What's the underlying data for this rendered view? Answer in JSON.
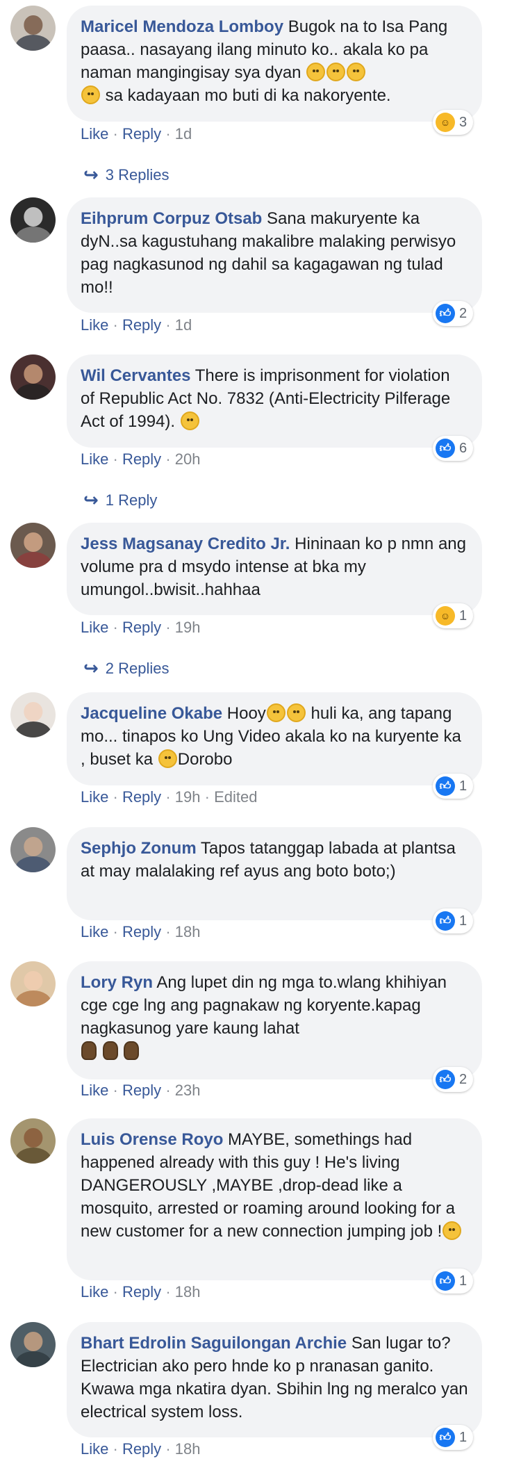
{
  "labels": {
    "like": "Like",
    "reply": "Reply",
    "sep": "·",
    "edited": "Edited"
  },
  "colors": {
    "link": "#385898",
    "bubble": "#f2f3f5",
    "like_blue": "#1877f2",
    "haha_yellow": "#f7b928"
  },
  "comments": [
    {
      "name": "Maricel Mendoza Lomboy",
      "text": " Bugok na to Isa Pang paasa.. nasayang ilang minuto ko.. akala ko pa naman mangingisay sya dyan ",
      "text_after": " sa kadayaan mo buti di ka nakoryente.",
      "emojis_inline": [
        "rofl-emoji",
        "rofl-emoji",
        "rofl-emoji"
      ],
      "emoji_start_line": "rofl-emoji",
      "time": "1d",
      "reaction": {
        "icon": "haha-icon",
        "count": "3"
      },
      "replies_label": "3 Replies"
    },
    {
      "name": "Eihprum Corpuz Otsab",
      "text": " Sana makuryente ka dyN..sa kagustuhang makalibre malaking perwisyo pag nagkasunod ng dahil sa kagagawan ng tulad mo!!",
      "time": "1d",
      "reaction": {
        "icon": "like-icon",
        "count": "2"
      }
    },
    {
      "name": "Wil Cervantes",
      "text": " There is imprisonment for violation of Republic Act No. 7832 (Anti-Electricity Pilferage Act of 1994). ",
      "emoji_end": "thinking-emoji",
      "time": "20h",
      "reaction": {
        "icon": "like-icon",
        "count": "6"
      },
      "replies_label": "1 Reply"
    },
    {
      "name": "Jess Magsanay Credito Jr.",
      "text": " Hininaan ko p nmn ang volume pra d msydo intense at bka my umungol..bwisit..hahhaa",
      "time": "19h",
      "reaction": {
        "icon": "haha-icon",
        "count": "1"
      },
      "replies_label": "2 Replies"
    },
    {
      "name": "Jacqueline Okabe",
      "text_a": " Hooy",
      "text_b": " huli ka, ang tapang mo... tinapos ko Ung Video akala ko na kuryente ka , buset ka ",
      "text_c": "Dorobo",
      "time": "19h",
      "edited": true,
      "reaction": {
        "icon": "like-icon",
        "count": "1"
      }
    },
    {
      "name": "Sephjo Zonum",
      "text": " Tapos tatanggap labada at plantsa at may malalaking ref ayus ang boto boto;)",
      "time": "18h",
      "reaction": {
        "icon": "like-icon",
        "count": "1"
      }
    },
    {
      "name": "Lory Ryn",
      "text": " Ang lupet din ng mga to.wlang khihiyan cge cge lng ang pagnakaw ng koryente.kapag nagkasunog yare kaung lahat",
      "time": "23h",
      "reaction": {
        "icon": "like-icon",
        "count": "2"
      }
    },
    {
      "name": "Luis Orense Royo",
      "text": " MAYBE, somethings had happened already with this guy ! He's living DANGEROUSLY ,MAYBE ,drop-dead like a mosquito, arrested or roaming around looking for a new customer for a new connection jumping job !",
      "time": "18h",
      "reaction": {
        "icon": "like-icon",
        "count": "1"
      }
    },
    {
      "name": "Bhart Edrolin Saguilongan Archie",
      "text": " San lugar to? Electrician ako pero hnde ko p nranasan ganito. Kwawa mga nkatira dyan. Sbihin lng ng meralco yan electrical system loss.",
      "time": "18h",
      "reaction": {
        "icon": "like-icon",
        "count": "1"
      }
    }
  ]
}
